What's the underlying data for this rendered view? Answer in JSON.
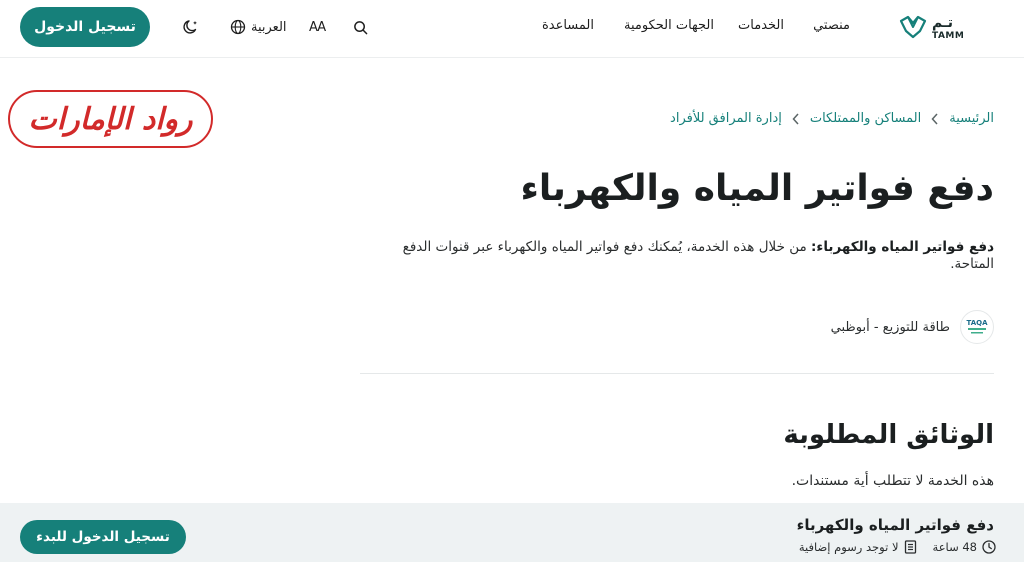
{
  "header": {
    "logo_ar": "تـم",
    "logo_en": "TAMM",
    "nav": [
      "منصتي",
      "الخدمات",
      "الجهات الحكومية",
      "المساعدة"
    ],
    "text_size_label": "AA",
    "language_label": "العربية",
    "login_label": "تسجيل الدخول",
    "icons": [
      "tamm-logo",
      "search-icon",
      "text-size-icon",
      "globe-icon",
      "moon-icon"
    ]
  },
  "watermark": {
    "text": "رواد الإمارات"
  },
  "breadcrumb": [
    "الرئيسية",
    "المساكن والممتلكات",
    "إدارة المرافق للأفراد"
  ],
  "page_title": "دفع فواتير المياه والكهرباء",
  "description": {
    "bold": "دفع فواتير المياه والكهرباء:",
    "text": " من خلال هذه الخدمة، يُمكنك دفع فواتير المياه والكهرباء عبر قنوات الدفع المتاحة."
  },
  "provider": {
    "name": "طاقة للتوزيع - أبوظبي",
    "logo_text": "TAQA"
  },
  "required_docs": {
    "title": "الوثائق المطلوبة",
    "text": "هذه الخدمة لا تتطلب أية مستندات."
  },
  "bottom_bar": {
    "title": "دفع فواتير المياه والكهرباء",
    "duration": "48 ساعة",
    "fees": "لا توجد رسوم إضافية",
    "start_label": "تسجيل الدخول للبدء"
  },
  "colors": {
    "primary": "#16807a",
    "watermark": "#d22a2a",
    "bottom_bar_bg": "#eef2f3"
  }
}
